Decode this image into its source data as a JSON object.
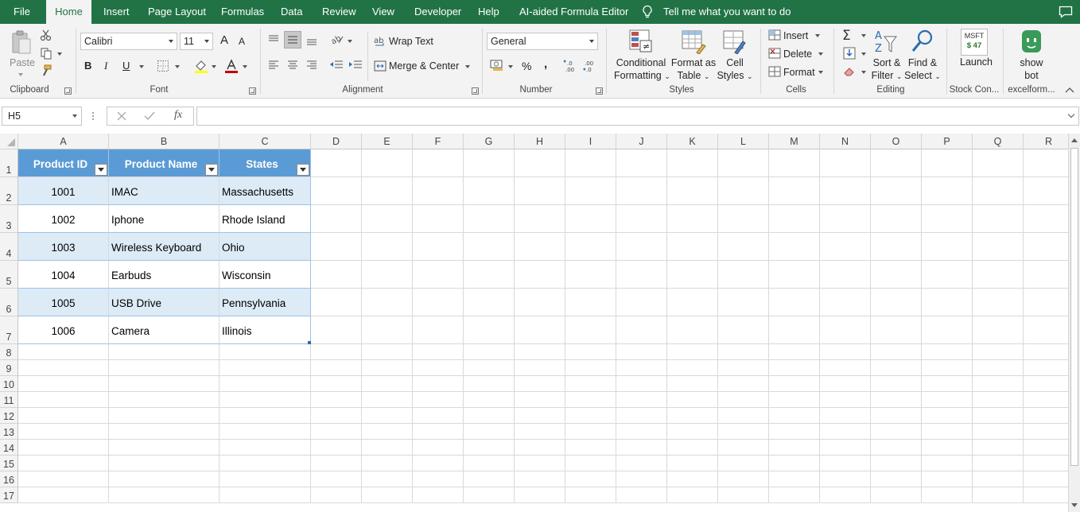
{
  "menu": {
    "tabs": [
      {
        "label": "File"
      },
      {
        "label": "Home"
      },
      {
        "label": "Insert"
      },
      {
        "label": "Page Layout"
      },
      {
        "label": "Formulas"
      },
      {
        "label": "Data"
      },
      {
        "label": "Review"
      },
      {
        "label": "View"
      },
      {
        "label": "Developer"
      },
      {
        "label": "Help"
      },
      {
        "label": "AI-aided Formula Editor"
      }
    ],
    "tell_me": "Tell me what you want to do",
    "active_tab": "Home"
  },
  "ribbon": {
    "clipboard": {
      "paste": "Paste",
      "label": "Clipboard"
    },
    "font": {
      "name": "Calibri",
      "size": "11",
      "bold": "B",
      "italic": "I",
      "underline": "U",
      "grow": "A",
      "shrink": "A",
      "label": "Font"
    },
    "alignment": {
      "wrap_text": "Wrap Text",
      "merge_center": "Merge & Center",
      "label": "Alignment"
    },
    "number": {
      "format": "General",
      "percent": "%",
      "comma": ",",
      "label": "Number"
    },
    "styles": {
      "conditional_1": "Conditional",
      "conditional_2": "Formatting",
      "format_table_1": "Format as",
      "format_table_2": "Table",
      "cell_styles_1": "Cell",
      "cell_styles_2": "Styles",
      "label": "Styles"
    },
    "cells": {
      "insert": "Insert",
      "delete": "Delete",
      "format": "Format",
      "label": "Cells"
    },
    "editing": {
      "sort_1": "Sort &",
      "sort_2": "Filter",
      "find_1": "Find &",
      "find_2": "Select",
      "label": "Editing"
    },
    "stock": {
      "ticker": "MSFT",
      "price": "$ 47",
      "launch": "Launch",
      "label": "Stock Con..."
    },
    "bot": {
      "line1": "show",
      "line2": "bot",
      "label": "excelform..."
    }
  },
  "formula_bar": {
    "name_box": "H5",
    "fx": "fx",
    "value": ""
  },
  "columns": [
    "A",
    "B",
    "C",
    "D",
    "E",
    "F",
    "G",
    "H",
    "I",
    "J",
    "K",
    "L",
    "M",
    "N",
    "O",
    "P",
    "Q",
    "R"
  ],
  "rows": [
    "1",
    "2",
    "3",
    "4",
    "5",
    "6",
    "7",
    "8",
    "9",
    "10",
    "11",
    "12",
    "13",
    "14",
    "15",
    "16",
    "17"
  ],
  "table": {
    "headers": [
      "Product ID",
      "Product Name",
      "States"
    ],
    "rows": [
      [
        "1001",
        "IMAC",
        "Massachusetts"
      ],
      [
        "1002",
        "Iphone",
        "Rhode Island"
      ],
      [
        "1003",
        "Wireless Keyboard",
        "Ohio"
      ],
      [
        "1004",
        "Earbuds",
        "Wisconsin"
      ],
      [
        "1005",
        "USB Drive",
        "Pennsylvania"
      ],
      [
        "1006",
        "Camera",
        "Illinois"
      ]
    ]
  },
  "colors": {
    "brand": "#217346",
    "table_header": "#5b9bd5",
    "table_band": "#ddebf7"
  }
}
